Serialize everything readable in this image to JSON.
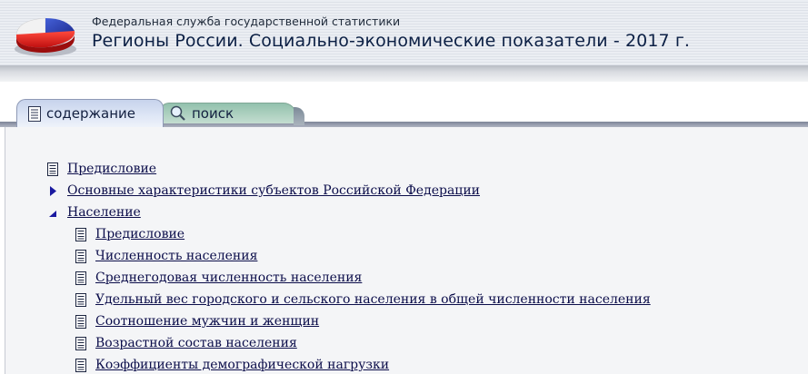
{
  "header": {
    "agency": "Федеральная служба государственной статистики",
    "title": "Регионы России. Социально-экономические показатели - 2017 г."
  },
  "tabs": [
    {
      "label": "содержание",
      "icon": "document-icon",
      "active": true
    },
    {
      "label": "поиск",
      "icon": "magnifier-icon",
      "active": false
    }
  ],
  "toc": {
    "items": [
      {
        "label": "Предисловие",
        "icon": "document-icon",
        "level": 0
      },
      {
        "label": "Основные характеристики субъектов Российской Федерации",
        "icon": "triangle-collapsed-icon",
        "level": 0
      },
      {
        "label": "Население",
        "icon": "triangle-expanded-icon",
        "level": 0
      },
      {
        "label": "Предисловие",
        "icon": "document-icon",
        "level": 1
      },
      {
        "label": "Численность населения",
        "icon": "document-icon",
        "level": 1
      },
      {
        "label": "Среднегодовая численность населения",
        "icon": "document-icon",
        "level": 1
      },
      {
        "label": "Удельный вес городского и сельского населения в общей численности населения",
        "icon": "document-icon",
        "level": 1
      },
      {
        "label": "Соотношение мужчин и женщин",
        "icon": "document-icon",
        "level": 1
      },
      {
        "label": "Возрастной состав населения",
        "icon": "document-icon",
        "level": 1
      },
      {
        "label": "Коэффициенты демографической нагрузки",
        "icon": "document-icon",
        "level": 1
      }
    ]
  },
  "colors": {
    "link": "#0b0d4a",
    "tab_active": "#dfe7f6",
    "tab_inactive": "#aed1c0",
    "triangle": "#1a1aa0"
  }
}
